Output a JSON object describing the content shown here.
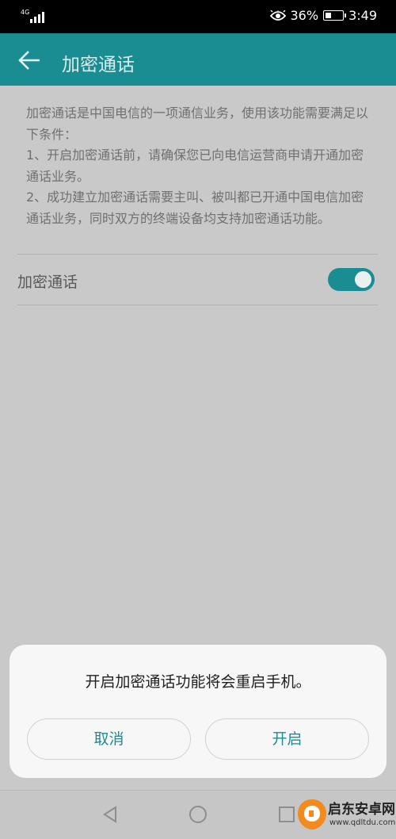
{
  "status_bar": {
    "network": "4G",
    "battery_percent": "36%",
    "battery_level": 0.36,
    "time": "3:49",
    "icons": [
      "signal-icon",
      "eye-comfort-icon",
      "battery-icon"
    ]
  },
  "app_bar": {
    "title": "加密通话",
    "back_icon": "arrow-left-icon"
  },
  "description": [
    "加密通话是中国电信的一项通信业务，使用该功能需要满足以下条件：",
    "1、开启加密通话前，请确保您已向电信运营商申请开通加密通话业务。",
    "2、成功建立加密通话需要主叫、被叫都已开通中国电信加密通话业务，同时双方的终端设备均支持加密通话功能。"
  ],
  "setting": {
    "label": "加密通话",
    "enabled": true
  },
  "dialog": {
    "message": "开启加密通话功能将会重启手机。",
    "cancel_label": "取消",
    "confirm_label": "开启"
  },
  "nav_bar": {
    "icons": [
      "back-triangle-icon",
      "home-circle-icon",
      "recents-square-icon"
    ]
  },
  "watermark": {
    "text": "启东安卓网",
    "url": "www.qdltdu.com"
  },
  "colors": {
    "accent": "#1a8d93",
    "dim_background": "#c9c9c9",
    "dialog_background": "#f7f7f7"
  }
}
